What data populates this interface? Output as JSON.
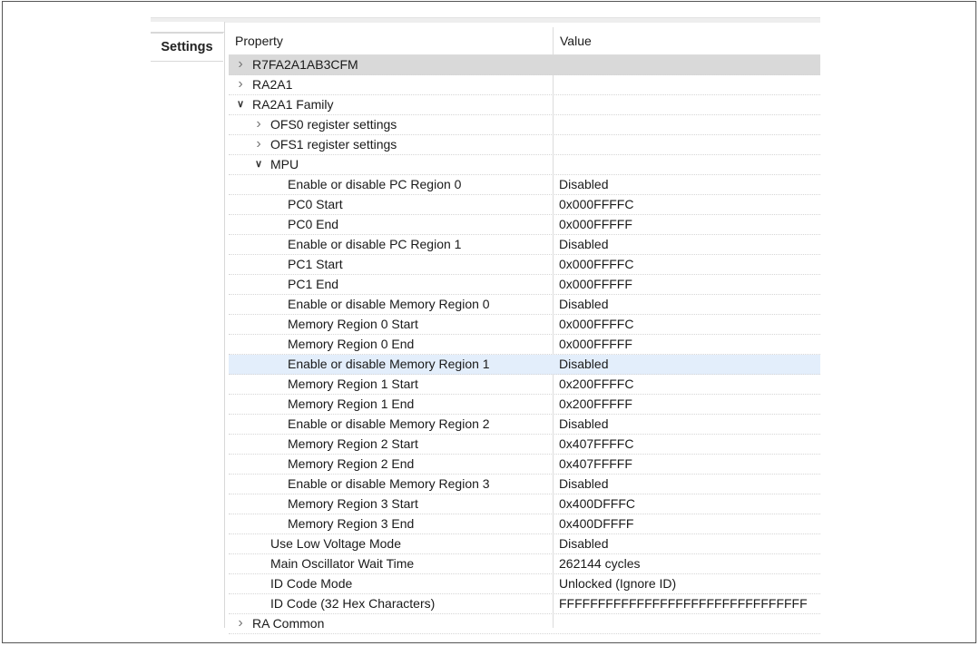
{
  "tabs": {
    "settings": "Settings"
  },
  "table": {
    "header_property": "Property",
    "header_value": "Value"
  },
  "rows": [
    {
      "label": "R7FA2A1AB3CFM",
      "value": "",
      "expander": "collapsed",
      "level": 0
    },
    {
      "label": "RA2A1",
      "value": "",
      "expander": "collapsed",
      "level": 0
    },
    {
      "label": "RA2A1 Family",
      "value": "",
      "expander": "expanded",
      "level": 0
    },
    {
      "label": "OFS0 register settings",
      "value": "",
      "expander": "collapsed",
      "level": 1
    },
    {
      "label": "OFS1 register settings",
      "value": "",
      "expander": "collapsed",
      "level": 1
    },
    {
      "label": "MPU",
      "value": "",
      "expander": "expanded",
      "level": 1
    },
    {
      "label": "Enable or disable PC Region 0",
      "value": "Disabled",
      "level": 2
    },
    {
      "label": "PC0 Start",
      "value": "0x000FFFFC",
      "level": 2
    },
    {
      "label": "PC0 End",
      "value": "0x000FFFFF",
      "level": 2
    },
    {
      "label": "Enable or disable PC Region 1",
      "value": "Disabled",
      "level": 2
    },
    {
      "label": "PC1 Start",
      "value": "0x000FFFFC",
      "level": 2
    },
    {
      "label": "PC1 End",
      "value": "0x000FFFFF",
      "level": 2
    },
    {
      "label": "Enable or disable Memory Region 0",
      "value": "Disabled",
      "level": 2
    },
    {
      "label": "Memory Region 0 Start",
      "value": "0x000FFFFC",
      "level": 2
    },
    {
      "label": "Memory Region 0 End",
      "value": "0x000FFFFF",
      "level": 2
    },
    {
      "label": "Enable or disable Memory Region 1",
      "value": "Disabled",
      "level": 2
    },
    {
      "label": "Memory Region 1 Start",
      "value": "0x200FFFFC",
      "level": 2
    },
    {
      "label": "Memory Region 1 End",
      "value": "0x200FFFFF",
      "level": 2
    },
    {
      "label": "Enable or disable Memory Region 2",
      "value": "Disabled",
      "level": 2
    },
    {
      "label": "Memory Region 2 Start",
      "value": "0x407FFFFC",
      "level": 2
    },
    {
      "label": "Memory Region 2 End",
      "value": "0x407FFFFF",
      "level": 2
    },
    {
      "label": "Enable or disable Memory Region 3",
      "value": "Disabled",
      "level": 2
    },
    {
      "label": "Memory Region 3 Start",
      "value": "0x400DFFFC",
      "level": 2
    },
    {
      "label": "Memory Region 3 End",
      "value": "0x400DFFFF",
      "level": 2
    },
    {
      "label": "Use Low Voltage Mode",
      "value": "Disabled",
      "level": 1
    },
    {
      "label": "Main Oscillator Wait Time",
      "value": "262144 cycles",
      "level": 1
    },
    {
      "label": "ID Code Mode",
      "value": "Unlocked (Ignore ID)",
      "level": 1
    },
    {
      "label": "ID Code (32 Hex Characters)",
      "value": "FFFFFFFFFFFFFFFFFFFFFFFFFFFFFFFF",
      "level": 1
    },
    {
      "label": "RA Common",
      "value": "",
      "expander": "collapsed",
      "level": 0
    }
  ],
  "colors": {
    "selected_gray": "#d9d9d9",
    "selected_blue": "#e3eefb"
  }
}
